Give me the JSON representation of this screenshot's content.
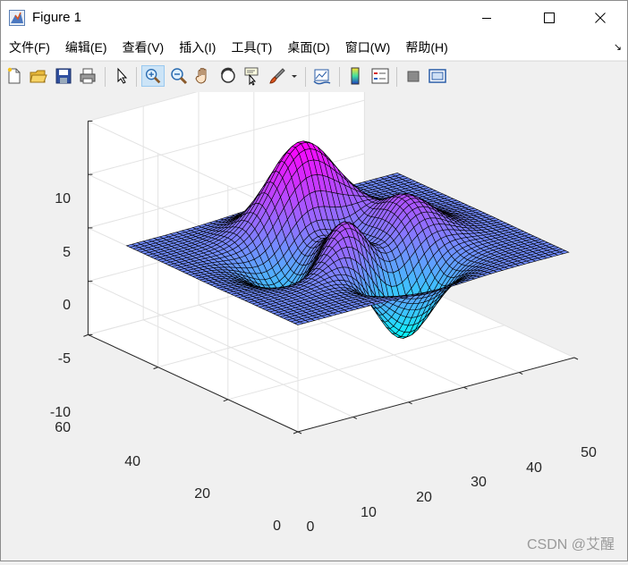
{
  "window": {
    "title": "Figure 1",
    "controls": [
      "minimize",
      "maximize",
      "close"
    ]
  },
  "menu": {
    "items": [
      {
        "label": "文件(F)"
      },
      {
        "label": "编辑(E)"
      },
      {
        "label": "查看(V)"
      },
      {
        "label": "插入(I)"
      },
      {
        "label": "工具(T)"
      },
      {
        "label": "桌面(D)"
      },
      {
        "label": "窗口(W)"
      },
      {
        "label": "帮助(H)"
      }
    ],
    "corner_glyph": "↘"
  },
  "toolbar": {
    "buttons": [
      "new-figure-icon",
      "open-file-icon",
      "save-icon",
      "print-icon",
      "select-arrow-icon",
      "zoom-in-icon",
      "zoom-out-icon",
      "pan-hand-icon",
      "rotate-3d-icon",
      "data-cursor-icon",
      "brush-icon",
      "brush-dropdown-icon",
      "link-plot-icon",
      "colorbar-icon",
      "legend-icon",
      "hide-plot-tools-icon",
      "show-plot-tools-icon"
    ],
    "active": "zoom-in-icon"
  },
  "plot": {
    "z_ticks": [
      "10",
      "5",
      "0",
      "-5",
      "-10"
    ],
    "y_ticks": [
      "60",
      "40",
      "20",
      "0"
    ],
    "x_ticks": [
      "0",
      "10",
      "20",
      "30",
      "40",
      "50"
    ],
    "colormap": "cool",
    "colors": {
      "low": "#00ffff",
      "high": "#ff00ff",
      "edge": "#000000"
    }
  },
  "chart_data": {
    "type": "surface",
    "function": "peaks",
    "x_range": [
      0,
      49
    ],
    "y_range": [
      0,
      49
    ],
    "zlim": [
      -10,
      10
    ],
    "xlim": [
      0,
      50
    ],
    "ylim": [
      0,
      60
    ],
    "x_ticks": [
      0,
      10,
      20,
      30,
      40,
      50
    ],
    "y_ticks": [
      0,
      20,
      40,
      60
    ],
    "z_ticks": [
      -10,
      -5,
      0,
      5,
      10
    ],
    "grid": true,
    "colormap": "cool",
    "z_peak_max": 8.1,
    "z_peak_min": -6.5
  },
  "watermark": "CSDN @艾醒"
}
